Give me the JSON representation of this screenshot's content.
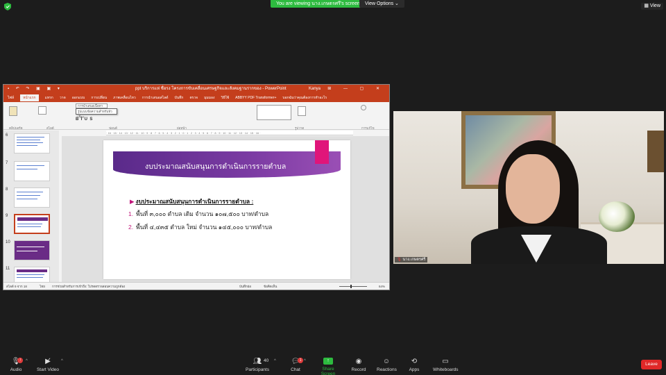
{
  "top": {
    "share_banner": "You are viewing นาง.เกษตรศรี's screen",
    "view_options": "View Options ⌄",
    "view_button": "▦ View"
  },
  "ppt": {
    "title": "ppt บริการแห่ ชื่อรง โครงการขับเคลื่อนเศรษฐกิจและสังคมฐานรากของ - PowerPoint",
    "user": "Kanya",
    "quick_access": "▪ ↶ ↷ ▣ ▣ ▾",
    "window_controls": "⊞ — ▢ ✕",
    "tabs": [
      "ไฟล์",
      "หน้าแรก",
      "แทรก",
      "วาด",
      "ออกแบบ",
      "การเปลี่ยน",
      "ภาพเคลื่อนไหว",
      "การนำเสนอสไลด์",
      "บันทึก",
      "ตรวจ",
      "มุมมอง",
      "วิธีใช้",
      "ABBYY PDF Transformer+",
      "บอกฉันว่าคุณต้องการทำอะไร"
    ],
    "active_tab": 1,
    "font_name": "การนำเสนอเนื้อหา",
    "font_dropdown": "รูปแบบข้อความสำหรับหัวเรื่อง",
    "ribbon_groups": [
      "คลิปบอร์ด",
      "สไลด์",
      "ฟอนต์",
      "ย่อหน้า",
      "รูปวาด",
      "การแก้ไข"
    ],
    "ruler": "· 16 · 15 · 14 · 13 · 12 · 11 · 10 · 9 · 8 · 7 · 6 · 5 · 4 · 3 · 2 · 1 · 0 · 1 · 2 · 3 · 4 · 5 · 6 · 7 · 8 · 9 · 10 · 11 · 12 · 13 · 14 · 15 · 16 ·",
    "thumb_numbers": [
      "6",
      "7",
      "8",
      "9",
      "10",
      "11"
    ],
    "selected_thumb": 3,
    "slide": {
      "title": "งบประมาณสนับสนุนการดำเนินการรายตำบล",
      "bullet": "งบประมาณสนับสนุนการดำเนินการรายตำบล :",
      "items": [
        {
          "n": "1.",
          "text": "พื้นที่ ๓,๐๐๐ ตำบล เดิม จำนวน ๑๐๗,๕๐๐ บาท/ตำบล"
        },
        {
          "n": "2.",
          "text": "พื้นที่ ๔,๔๓๕ ตำบล ใหม่ จำนวน ๑๔๕,๐๐๐ บาท/ตำบล"
        }
      ]
    },
    "status": {
      "slide_of": "สไลด์ 9 จาก 18",
      "lang": "ไทย",
      "accessibility": "การช่วยสำหรับการเข้าถึง: โปรดตรวจสอบความถูกต้อง",
      "notes": "บันทึกย่อ",
      "comments": "ข้อคิดเห็น",
      "zoom": "64%"
    }
  },
  "video": {
    "name": "นาง.เกษตรศรี"
  },
  "toolbar": {
    "audio": "Audio",
    "start_video": "Start Video",
    "participants": "Participants",
    "participants_count": "40",
    "chat": "Chat",
    "chat_badge": "1",
    "share_screen": "Share Screen",
    "record": "Record",
    "reactions": "Reactions",
    "apps": "Apps",
    "whiteboards": "Whiteboards",
    "leave": "Leave"
  },
  "colors": {
    "ppt_accent": "#c43e1c",
    "share_green": "#2dbb3f",
    "leave_red": "#e02828",
    "slide_banner": "#6a2c86",
    "slide_pink": "#e0157a"
  }
}
